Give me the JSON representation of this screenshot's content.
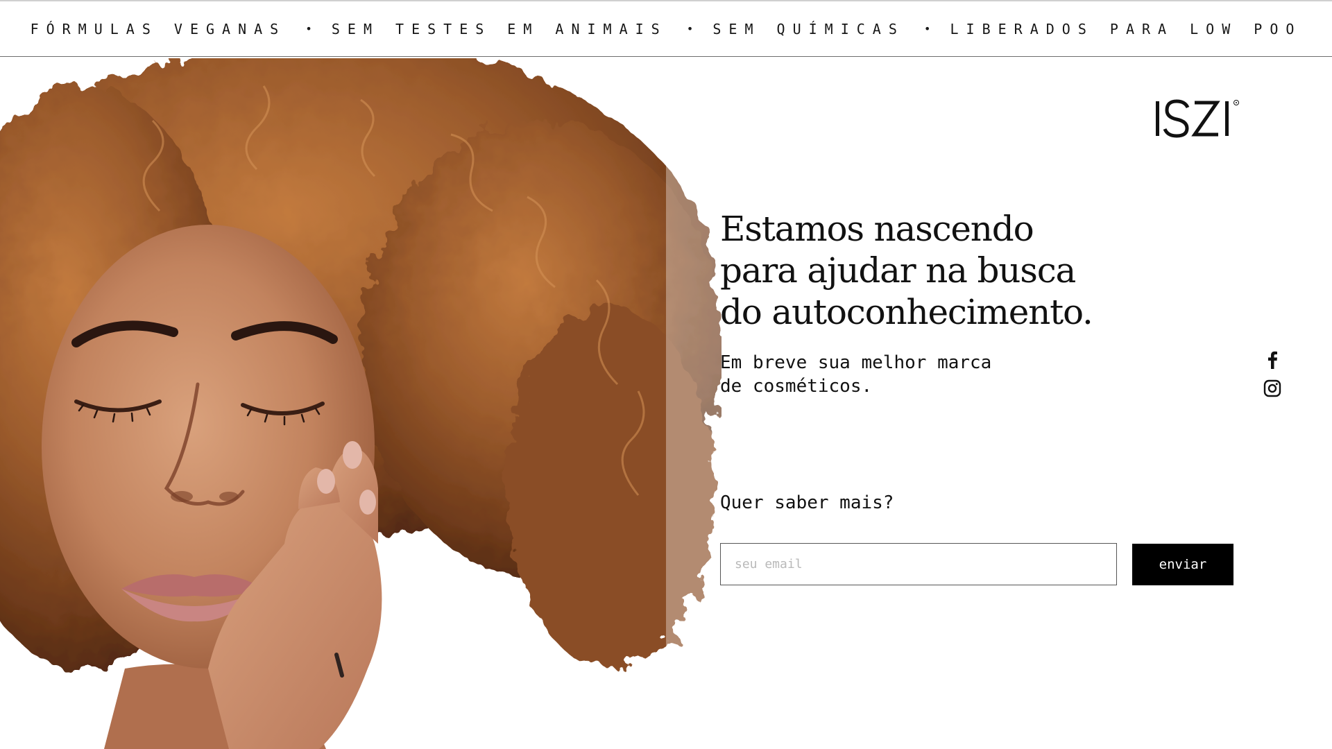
{
  "banner": {
    "items": [
      "FÓRMULAS VEGANAS",
      "SEM TESTES EM ANIMAIS",
      "SEM QUÍMICAS",
      "LIBERADOS PARA LOW POO"
    ],
    "separator": "•"
  },
  "logo": {
    "text": "ISZI"
  },
  "hero": {
    "headline_lines": [
      "Estamos nascendo",
      "para ajudar na busca",
      "do autoconhecimento."
    ],
    "subtext_lines": [
      "Em breve sua melhor marca",
      "de cosméticos."
    ]
  },
  "signup": {
    "question": "Quer saber mais?",
    "email_placeholder": "seu email",
    "submit_label": "enviar"
  },
  "social": {
    "icons": [
      "facebook-icon",
      "instagram-icon"
    ]
  },
  "colors": {
    "button_bg": "#000000",
    "button_text": "#ffffff",
    "hair": "#9a5a2c",
    "skin": "#c98a66"
  }
}
